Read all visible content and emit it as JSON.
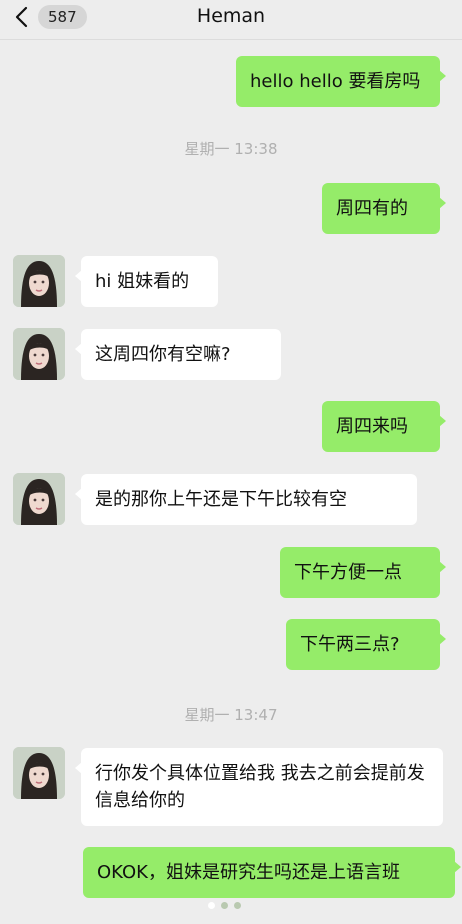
{
  "header": {
    "back_count": "587",
    "title": "Heman"
  },
  "messages": {
    "m1": "hello hello 要看房吗",
    "ts1": "星期一 13:38",
    "m2": "周四有的",
    "m3": "hi 姐妹看的",
    "m4": "这周四你有空嘛?",
    "m5": "周四来吗",
    "m6": "是的那你上午还是下午比较有空",
    "m7": "下午方便一点",
    "m8": "下午两三点?",
    "ts2": "星期一 13:47",
    "m9": "行你发个具体位置给我 我去之前会提前发信息给你的",
    "m10": "OKOK，姐妹是研究生吗还是上语言班"
  },
  "colors": {
    "background": "#ededed",
    "outgoing_bubble": "#95ec69",
    "incoming_bubble": "#ffffff",
    "timestamp_text": "#b0b0b0"
  },
  "icons": {
    "back": "chevron-left-icon",
    "avatar": "contact-avatar"
  },
  "pager": {
    "pages": 3,
    "active": 1
  }
}
